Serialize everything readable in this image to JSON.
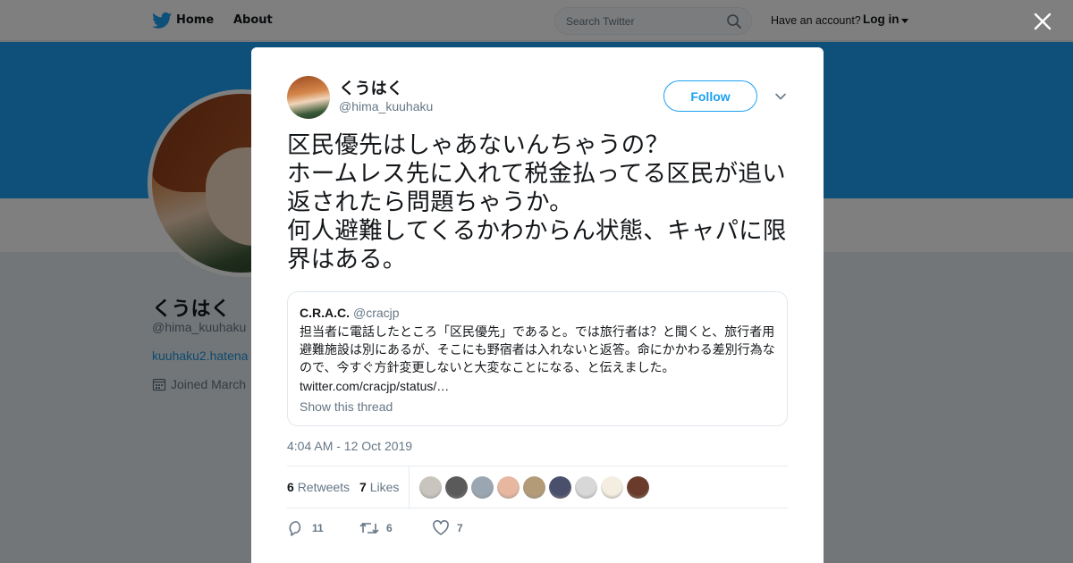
{
  "nav": {
    "home": "Home",
    "about": "About",
    "search_placeholder": "Search Twitter",
    "have_account": "Have an account?",
    "login": "Log in"
  },
  "profile": {
    "name": "くうはく",
    "handle": "@hima_kuuhaku",
    "link": "kuuhaku2.hatena",
    "joined": "Joined March"
  },
  "tweet": {
    "author_name": "くうはく",
    "author_handle": "@hima_kuuhaku",
    "follow_label": "Follow",
    "text": "区民優先はしゃあないんちゃうの？\nホームレス先に入れて税金払ってる区民が追い返されたら問題ちゃうか。\n何人避難してくるかわからん状態、キャパに限界はある。",
    "timestamp": "4:04 AM - 12 Oct 2019",
    "retweets": "6",
    "retweets_label": "Retweets",
    "likes": "7",
    "likes_label": "Likes",
    "replies_count": "11",
    "retweet_count": "6",
    "like_count": "7"
  },
  "quote": {
    "name": "C.R.A.C.",
    "handle": "@cracjp",
    "text": "担当者に電話したところ「区民優先」であると。では旅行者は？と聞くと、旅行者用避難施設は別にあるが、そこにも野宿者は入れないと返答。命にかかわる差別行為なので、今すぐ方針変更しないと大変なことになる、と伝えました。",
    "link": "twitter.com/cracjp/status/…",
    "show_thread": "Show this thread"
  },
  "colors": {
    "brand": "#1da1f2",
    "banner": "#1da1f2",
    "text": "#14171a",
    "muted": "#657786"
  },
  "likers": [
    {
      "icon": "liker-avatar-1",
      "color": "#c9c4bd"
    },
    {
      "icon": "liker-avatar-2",
      "color": "#5a5a5a"
    },
    {
      "icon": "liker-avatar-3",
      "color": "#9aa6b2"
    },
    {
      "icon": "liker-avatar-4",
      "color": "#e8b7a0"
    },
    {
      "icon": "liker-avatar-5",
      "color": "#b39b78"
    },
    {
      "icon": "liker-avatar-6",
      "color": "#4a4f6b"
    },
    {
      "icon": "liker-avatar-7",
      "color": "#d8d8d8"
    },
    {
      "icon": "liker-avatar-8",
      "color": "#f3eee0"
    },
    {
      "icon": "liker-avatar-9",
      "color": "#6a3a2a"
    }
  ]
}
